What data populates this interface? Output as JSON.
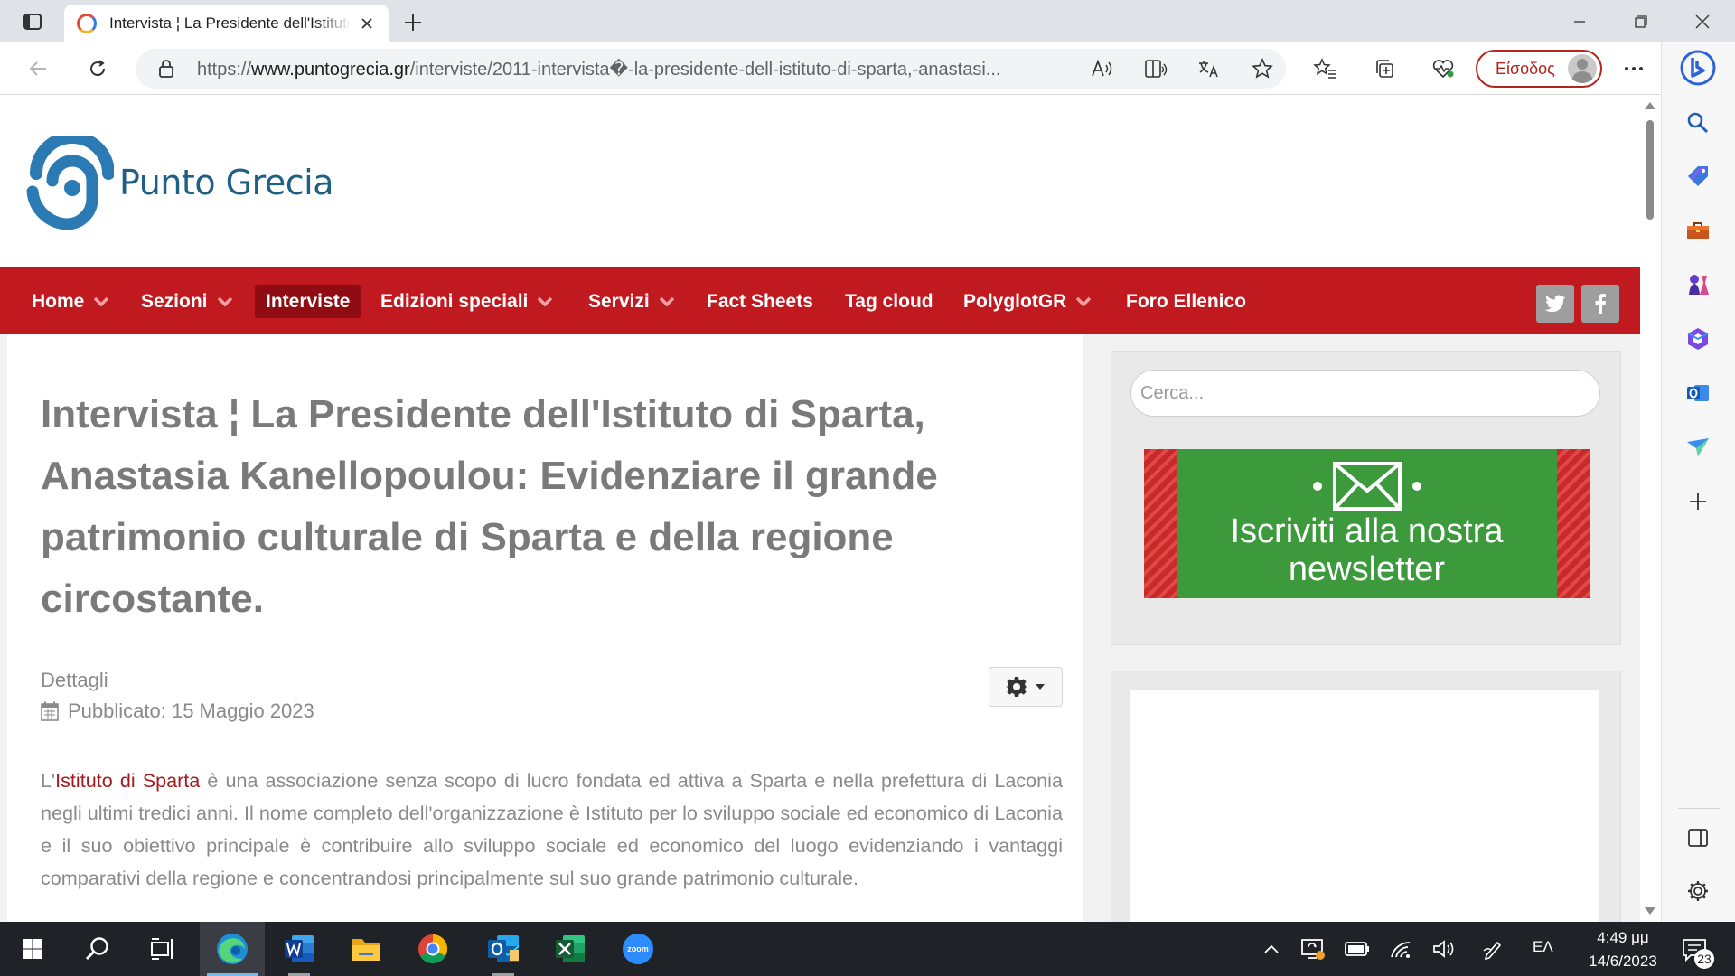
{
  "browser": {
    "tab_title": "Intervista ¦ La Presidente dell'Istituto di Sparta",
    "url_prefix": "https://",
    "url_domain": "www.puntogrecia.gr",
    "url_path": "/interviste/2011-intervista�-la-presidente-dell-istituto-di-sparta,-anastasi...",
    "signin_label": "Είσοδος"
  },
  "site": {
    "logo_text": "Punto Grecia",
    "nav": [
      {
        "label": "Home",
        "dropdown": true
      },
      {
        "label": "Sezioni",
        "dropdown": true
      },
      {
        "label": "Interviste",
        "dropdown": false,
        "active": true
      },
      {
        "label": "Edizioni speciali",
        "dropdown": true
      },
      {
        "label": "Servizi",
        "dropdown": true
      },
      {
        "label": "Fact Sheets",
        "dropdown": false
      },
      {
        "label": "Tag cloud",
        "dropdown": false
      },
      {
        "label": "PolyglotGR",
        "dropdown": true
      },
      {
        "label": "Foro Ellenico",
        "dropdown": false
      }
    ],
    "social": [
      "twitter-icon",
      "facebook-icon"
    ]
  },
  "article": {
    "title": "Intervista ¦ La Presidente dell'Istituto di Sparta, Anastasia Kanellopoulou: Evidenziare il grande patrimonio culturale di Sparta e della regione circostante.",
    "details_label": "Dettagli",
    "published": "Pubblicato: 15 Maggio 2023",
    "body_prefix": "L'",
    "body_link": "Istituto di Sparta",
    "body_rest": " è una associazione senza scopo di lucro fondata ed attiva a Sparta e nella prefettura di Laconia negli ultimi tredici anni. Il nome completo dell'organizzazione è Istituto per lo sviluppo sociale ed economico di Laconia e il suo obiettivo principale è contribuire allo sviluppo sociale ed economico del luogo evidenziando i vantaggi comparativi della regione e concentrandosi principalmente sul suo grande patrimonio culturale."
  },
  "sidebar": {
    "search_placeholder": "Cerca...",
    "newsletter_line1": "Iscriviti alla nostra",
    "newsletter_line2": "newsletter"
  },
  "taskbar": {
    "language": "ΕΛ",
    "time": "4:49 μμ",
    "date": "14/6/2023",
    "notification_count": "23"
  },
  "colors": {
    "nav_red": "#c0191f",
    "nav_active": "#8f0d12",
    "link_red": "#a31a1e",
    "newsletter_green": "#3c9a3c",
    "logo_blue": "#2b7ab3"
  }
}
